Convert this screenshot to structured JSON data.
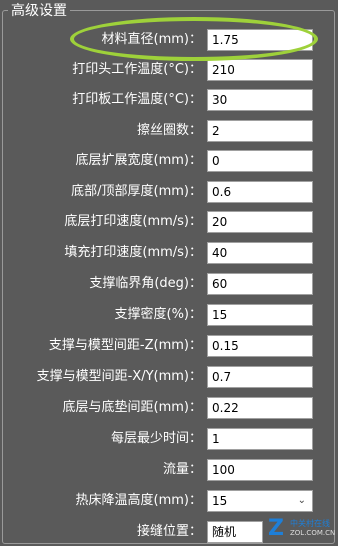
{
  "panel": {
    "title": "高级设置"
  },
  "settings": [
    {
      "label": "材料直径(mm)：",
      "value": "1.75"
    },
    {
      "label": "打印头工作温度(°C)：",
      "value": "210"
    },
    {
      "label": "打印板工作温度(°C)：",
      "value": "30"
    },
    {
      "label": "擦丝圈数：",
      "value": "2"
    },
    {
      "label": "底层扩展宽度(mm)：",
      "value": "0"
    },
    {
      "label": "底部/顶部厚度(mm)：",
      "value": "0.6"
    },
    {
      "label": "底层打印速度(mm/s)：",
      "value": "20"
    },
    {
      "label": "填充打印速度(mm/s)：",
      "value": "40"
    },
    {
      "label": "支撑临界角(deg)：",
      "value": "60"
    },
    {
      "label": "支撑密度(%)：",
      "value": "15"
    },
    {
      "label": "支撑与模型间距-Z(mm)：",
      "value": "0.15"
    },
    {
      "label": "支撑与模型间距-X/Y(mm)：",
      "value": "0.7"
    },
    {
      "label": "底层与底垫间距(mm)：",
      "value": "0.22"
    },
    {
      "label": "每层最少时间：",
      "value": "1"
    },
    {
      "label": "流量：",
      "value": "100"
    },
    {
      "label": "热床降温高度(mm)：",
      "value": "15"
    },
    {
      "label": "接缝位置：",
      "value": "随机"
    }
  ],
  "watermark": {
    "brand": "中关村在线",
    "url": "ZOL.COM.CN",
    "icon": "zol-logo-icon"
  },
  "colors": {
    "background": "#5a5a5a",
    "highlight": "#9ed13a",
    "text": "#ffffff"
  }
}
